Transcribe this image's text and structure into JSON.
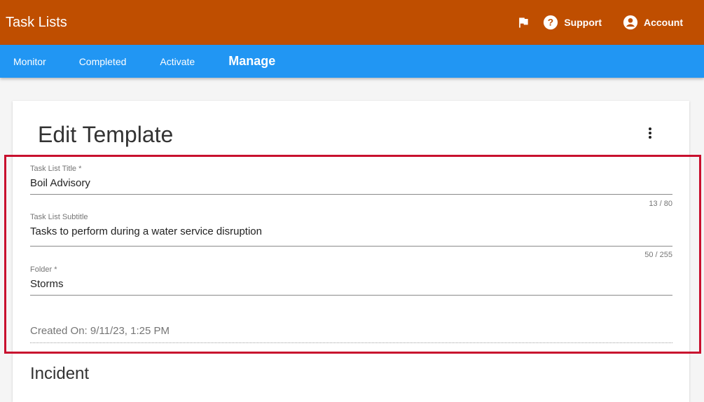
{
  "header": {
    "title": "Task Lists",
    "support_label": "Support",
    "account_label": "Account",
    "icons": [
      "flag-icon",
      "help-circle-icon",
      "account-circle-icon"
    ]
  },
  "tabs": [
    {
      "label": "Monitor",
      "active": false
    },
    {
      "label": "Completed",
      "active": false
    },
    {
      "label": "Activate",
      "active": false
    },
    {
      "label": "Manage",
      "active": true
    }
  ],
  "card": {
    "title": "Edit Template",
    "menu_icon": "more-vert-icon"
  },
  "form": {
    "title_field": {
      "label": "Task List Title *",
      "value": "Boil Advisory",
      "counter": "13 / 80"
    },
    "subtitle_field": {
      "label": "Task List Subtitle",
      "value": "Tasks to perform during a water service disruption",
      "counter": "50 / 255"
    },
    "folder_field": {
      "label": "Folder *",
      "value": "Storms"
    },
    "created_on": "Created On: 9/11/23, 1:25 PM"
  },
  "section": {
    "title": "Incident"
  },
  "colors": {
    "appbar": "#bf4e00",
    "tabbar": "#2196f3",
    "highlight": "#c8102e"
  }
}
